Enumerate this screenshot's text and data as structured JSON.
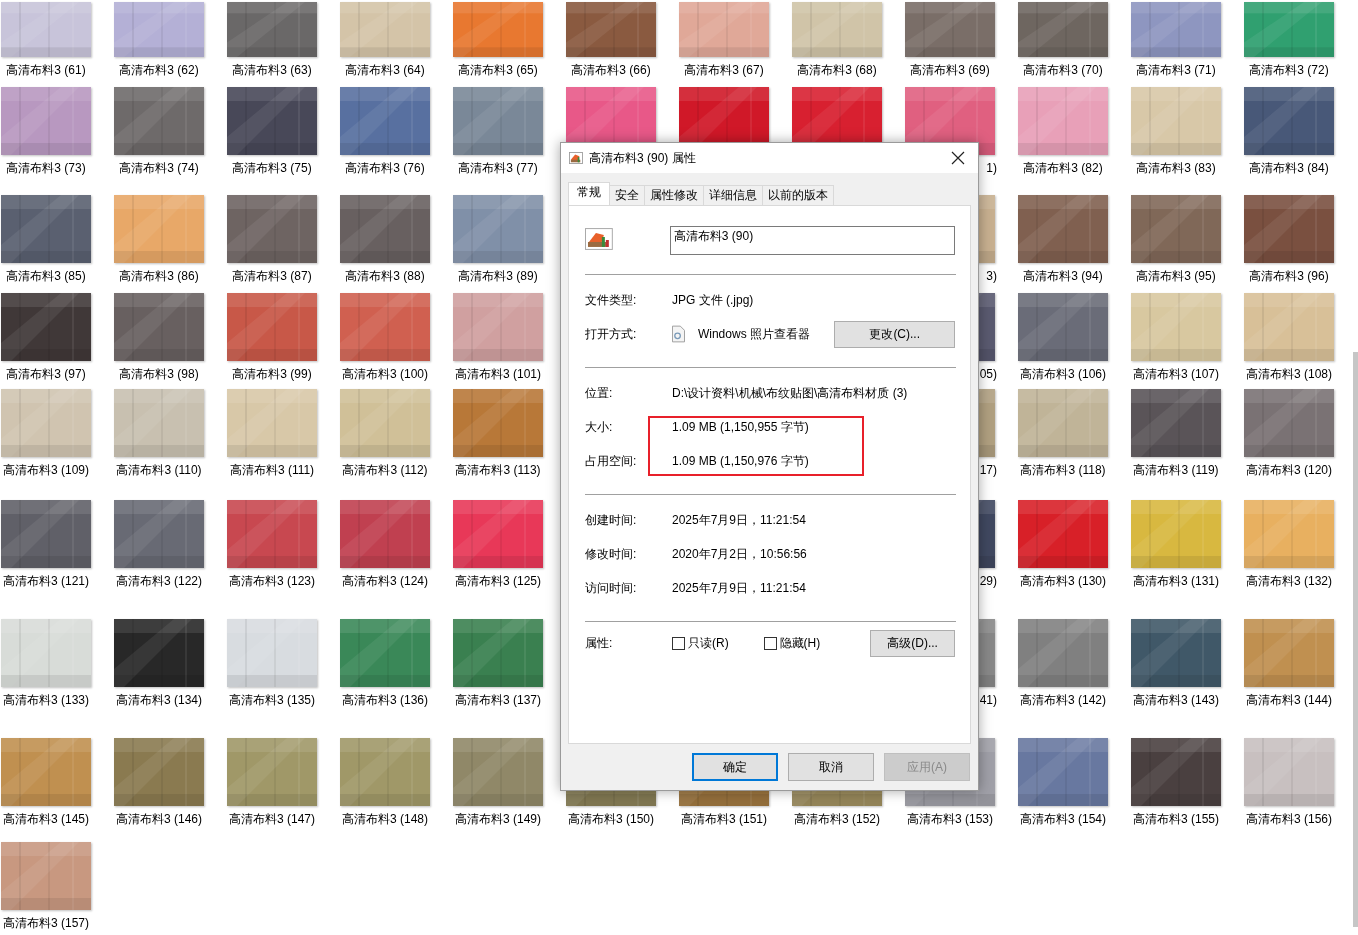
{
  "files": [
    {
      "kind": "file",
      "label": "高清布料3 (61)"
    },
    {
      "kind": "file",
      "label": "高清布料3 (62)"
    },
    {
      "kind": "file",
      "label": "高清布料3 (63)"
    },
    {
      "kind": "file",
      "label": "高清布料3 (64)"
    },
    {
      "kind": "file",
      "label": "高清布料3 (65)"
    },
    {
      "kind": "file",
      "label": "高清布料3 (66)"
    },
    {
      "kind": "file",
      "label": "高清布料3 (67)"
    },
    {
      "kind": "file",
      "label": "高清布料3 (68)"
    },
    {
      "kind": "file",
      "label": "高清布料3 (69)"
    },
    {
      "kind": "file",
      "label": "高清布料3 (70)"
    },
    {
      "kind": "file",
      "label": "高清布料3 (71)"
    },
    {
      "kind": "file",
      "label": "高清布料3 (72)"
    },
    {
      "kind": "file",
      "label": "高清布料3 (73)"
    },
    {
      "kind": "file",
      "label": "高清布料3 (74)"
    },
    {
      "kind": "file",
      "label": "高清布料3 (75)"
    },
    {
      "kind": "file",
      "label": "高清布料3 (76)"
    },
    {
      "kind": "file",
      "label": "高清布料3 (77)"
    },
    {
      "kind": "thumb"
    },
    {
      "kind": "thumb"
    },
    {
      "kind": "thumb"
    },
    {
      "kind": "partial",
      "label": "1)"
    },
    {
      "kind": "file",
      "label": "高清布料3 (82)"
    },
    {
      "kind": "file",
      "label": "高清布料3 (83)"
    },
    {
      "kind": "file",
      "label": "高清布料3 (84)"
    },
    {
      "kind": "file",
      "label": "高清布料3 (85)"
    },
    {
      "kind": "file",
      "label": "高清布料3 (86)"
    },
    {
      "kind": "file",
      "label": "高清布料3 (87)"
    },
    {
      "kind": "file",
      "label": "高清布料3 (88)"
    },
    {
      "kind": "file",
      "label": "高清布料3 (89)"
    },
    {
      "kind": "covered"
    },
    {
      "kind": "covered"
    },
    {
      "kind": "covered"
    },
    {
      "kind": "partial",
      "label": "3)"
    },
    {
      "kind": "file",
      "label": "高清布料3 (94)"
    },
    {
      "kind": "file",
      "label": "高清布料3 (95)"
    },
    {
      "kind": "file",
      "label": "高清布料3 (96)"
    },
    {
      "kind": "file",
      "label": "高清布料3 (97)"
    },
    {
      "kind": "file",
      "label": "高清布料3 (98)"
    },
    {
      "kind": "file",
      "label": "高清布料3 (99)"
    },
    {
      "kind": "file",
      "label": "高清布料3 (100)"
    },
    {
      "kind": "file",
      "label": "高清布料3 (101)"
    },
    {
      "kind": "covered"
    },
    {
      "kind": "covered"
    },
    {
      "kind": "covered"
    },
    {
      "kind": "partial",
      "label": "05)"
    },
    {
      "kind": "file",
      "label": "高清布料3 (106)"
    },
    {
      "kind": "file",
      "label": "高清布料3 (107)"
    },
    {
      "kind": "file",
      "label": "高清布料3 (108)"
    },
    {
      "kind": "file",
      "label": "高清布料3 (109)"
    },
    {
      "kind": "file",
      "label": "高清布料3 (110)"
    },
    {
      "kind": "file",
      "label": "高清布料3 (111)"
    },
    {
      "kind": "file",
      "label": "高清布料3 (112)"
    },
    {
      "kind": "file",
      "label": "高清布料3 (113)"
    },
    {
      "kind": "covered"
    },
    {
      "kind": "covered"
    },
    {
      "kind": "covered"
    },
    {
      "kind": "partial",
      "label": "17)"
    },
    {
      "kind": "file",
      "label": "高清布料3 (118)"
    },
    {
      "kind": "file",
      "label": "高清布料3 (119)"
    },
    {
      "kind": "file",
      "label": "高清布料3 (120)"
    },
    {
      "kind": "file",
      "label": "高清布料3 (121)"
    },
    {
      "kind": "file",
      "label": "高清布料3 (122)"
    },
    {
      "kind": "file",
      "label": "高清布料3 (123)"
    },
    {
      "kind": "file",
      "label": "高清布料3 (124)"
    },
    {
      "kind": "file",
      "label": "高清布料3 (125)"
    },
    {
      "kind": "covered"
    },
    {
      "kind": "covered"
    },
    {
      "kind": "covered"
    },
    {
      "kind": "partial",
      "label": "29)"
    },
    {
      "kind": "file",
      "label": "高清布料3 (130)"
    },
    {
      "kind": "file",
      "label": "高清布料3 (131)"
    },
    {
      "kind": "file",
      "label": "高清布料3 (132)"
    },
    {
      "kind": "file",
      "label": "高清布料3 (133)"
    },
    {
      "kind": "file",
      "label": "高清布料3 (134)"
    },
    {
      "kind": "file",
      "label": "高清布料3 (135)"
    },
    {
      "kind": "file",
      "label": "高清布料3 (136)"
    },
    {
      "kind": "file",
      "label": "高清布料3 (137)"
    },
    {
      "kind": "covered"
    },
    {
      "kind": "covered"
    },
    {
      "kind": "covered"
    },
    {
      "kind": "partial",
      "label": "41)"
    },
    {
      "kind": "file",
      "label": "高清布料3 (142)"
    },
    {
      "kind": "file",
      "label": "高清布料3 (143)"
    },
    {
      "kind": "file",
      "label": "高清布料3 (144)"
    },
    {
      "kind": "file",
      "label": "高清布料3 (145)"
    },
    {
      "kind": "file",
      "label": "高清布料3 (146)"
    },
    {
      "kind": "file",
      "label": "高清布料3 (147)"
    },
    {
      "kind": "file",
      "label": "高清布料3 (148)"
    },
    {
      "kind": "file",
      "label": "高清布料3 (149)"
    },
    {
      "kind": "file",
      "label": "高清布料3 (150)"
    },
    {
      "kind": "file",
      "label": "高清布料3 (151)"
    },
    {
      "kind": "file",
      "label": "高清布料3 (152)"
    },
    {
      "kind": "file",
      "label": "高清布料3 (153)"
    },
    {
      "kind": "file",
      "label": "高清布料3 (154)"
    },
    {
      "kind": "file",
      "label": "高清布料3 (155)"
    },
    {
      "kind": "file",
      "label": "高清布料3 (156)"
    },
    {
      "kind": "file",
      "label": "高清布料3 (157)"
    }
  ],
  "dialog": {
    "title": "高清布料3 (90) 属性",
    "tabs": [
      {
        "label": "常规",
        "selected": true
      },
      {
        "label": "安全",
        "selected": false
      },
      {
        "label": "属性修改",
        "selected": false
      },
      {
        "label": "详细信息",
        "selected": false
      },
      {
        "label": "以前的版本",
        "selected": false
      }
    ],
    "name_value": "高清布料3 (90)",
    "sections": [
      [
        {
          "kind": "text",
          "label": "文件类型:",
          "value": "JPG 文件 (.jpg)"
        },
        {
          "kind": "app",
          "label": "打开方式:",
          "value": "Windows 照片查看器",
          "button": "更改(C)..."
        }
      ],
      [
        {
          "kind": "text",
          "label": "位置:",
          "value": "D:\\设计资料\\机械\\布纹贴图\\高清布料材质 (3)"
        },
        {
          "kind": "text",
          "label": "大小:",
          "value": "1.09 MB (1,150,955 字节)"
        },
        {
          "kind": "text",
          "label": "占用空间:",
          "value": "1.09 MB (1,150,976 字节)"
        }
      ],
      [
        {
          "kind": "text",
          "label": "创建时间:",
          "value": "2025年7月9日，11:21:54"
        },
        {
          "kind": "text",
          "label": "修改时间:",
          "value": "2020年7月2日，10:56:56"
        },
        {
          "kind": "text",
          "label": "访问时间:",
          "value": "2025年7月9日，11:21:54"
        }
      ]
    ],
    "attributes": {
      "label": "属性:",
      "checkboxes": [
        {
          "label": "只读(R)",
          "checked": false
        },
        {
          "label": "隐藏(H)",
          "checked": false
        }
      ],
      "button": "高级(D)..."
    },
    "buttons": [
      {
        "label": "确定",
        "default": true,
        "disabled": false
      },
      {
        "label": "取消",
        "default": false,
        "disabled": false
      },
      {
        "label": "应用(A)",
        "default": false,
        "disabled": true
      }
    ]
  }
}
